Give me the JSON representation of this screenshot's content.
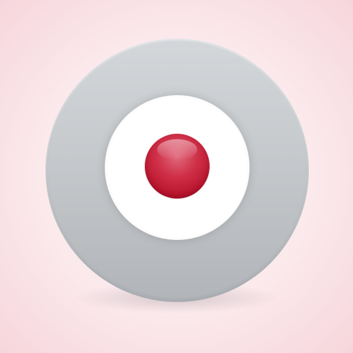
{
  "icon": {
    "name": "target-record-icon",
    "colors": {
      "background": "#fbe9ec",
      "outer_ring": "#c5c9cc",
      "inner_disc": "#ffffff",
      "center_dot": "#c8213a"
    }
  }
}
